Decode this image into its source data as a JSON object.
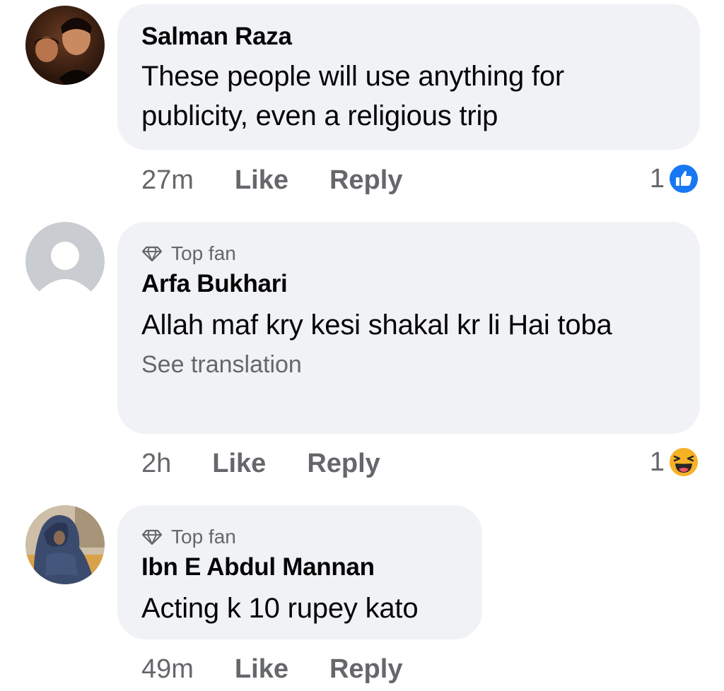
{
  "comments": [
    {
      "author": "Salman Raza",
      "top_fan": "",
      "text": "These people will use anything for publicity, even a religious trip",
      "see_translation": "",
      "time": "27m",
      "like_label": "Like",
      "reply_label": "Reply",
      "reaction_count": "1",
      "reaction_icon": "like-reaction-icon",
      "avatar_icon": "profile-photo"
    },
    {
      "author": "Arfa Bukhari",
      "top_fan": "Top fan",
      "text": "Allah maf kry kesi shakal kr li Hai toba",
      "see_translation": "See translation",
      "time": "2h",
      "like_label": "Like",
      "reply_label": "Reply",
      "reaction_count": "1",
      "reaction_icon": "haha-reaction-icon",
      "avatar_icon": "default-avatar"
    },
    {
      "author": "Ibn E Abdul Mannan",
      "top_fan": "Top fan",
      "text": "Acting k 10 rupey kato",
      "see_translation": "",
      "time": "49m",
      "like_label": "Like",
      "reply_label": "Reply",
      "reaction_count": "",
      "reaction_icon": "",
      "avatar_icon": "profile-photo"
    }
  ],
  "colors": {
    "bubble_bg": "#f0f2f5",
    "meta_text": "#65676b",
    "like_blue": "#1877f2",
    "haha_yellow": "#f7b125"
  }
}
